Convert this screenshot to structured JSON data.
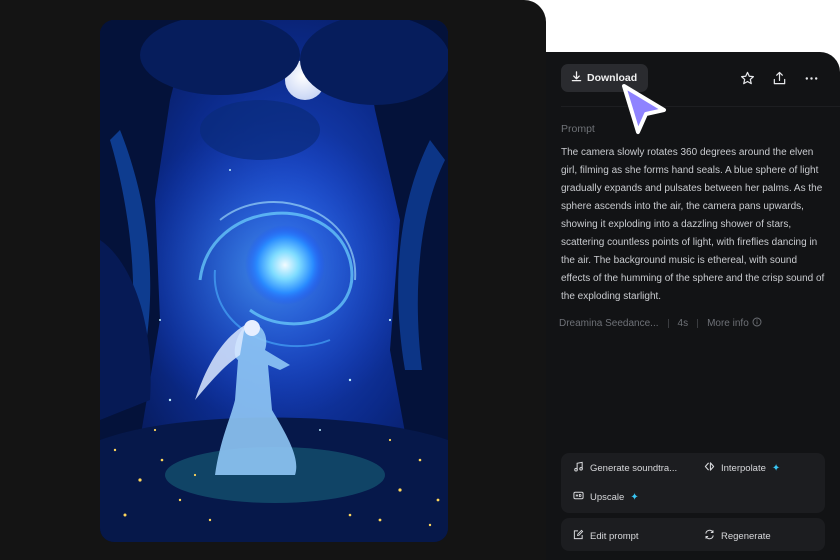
{
  "toolbar": {
    "download_label": "Download",
    "icons": [
      "download-icon",
      "star-icon",
      "share-icon",
      "more-icon"
    ]
  },
  "prompt": {
    "label": "Prompt",
    "text": "The camera slowly rotates 360 degrees around the elven girl, filming as she forms hand seals. A blue sphere of light gradually expands and pulsates between her palms. As the sphere ascends into the air, the camera pans upwards, showing it exploding into a dazzling shower of stars, scattering countless points of light, with fireflies dancing in the air. The background music is ethereal, with sound effects of the humming of the sphere and the crisp sound of the exploding starlight."
  },
  "meta": {
    "model": "Dreamina Seedance...",
    "duration": "4s",
    "more_info": "More info"
  },
  "tools": {
    "generate_soundtrack": "Generate soundtra...",
    "interpolate": "Interpolate",
    "upscale": "Upscale",
    "spark": "✦"
  },
  "actions": {
    "edit_prompt": "Edit prompt",
    "regenerate": "Regenerate"
  },
  "colors": {
    "panel_bg": "#121315",
    "card_bg": "#1c1d20",
    "accent_cursor": "#8f83ff",
    "spark": "#38c6f4"
  }
}
